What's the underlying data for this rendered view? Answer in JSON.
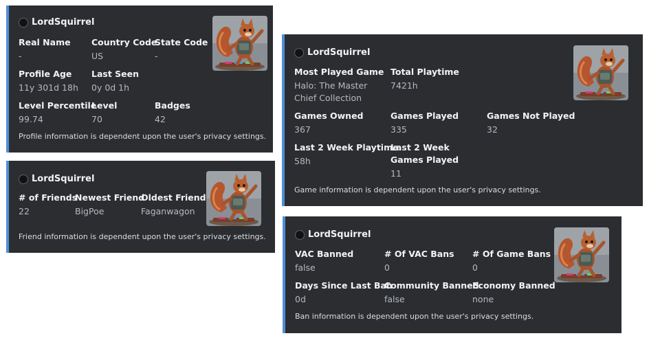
{
  "colors": {
    "embed_bg": "#2b2d31",
    "accent": "#4f8fd8",
    "page_bg": "#ffffff"
  },
  "profile": {
    "author": "LordSquirrel",
    "fields": [
      {
        "name": "Real Name",
        "value": "-"
      },
      {
        "name": "Country Code",
        "value": "US"
      },
      {
        "name": "State Code",
        "value": "-"
      },
      {
        "name": "Profile Age",
        "value": "11y 301d 18h"
      },
      {
        "name": "Last Seen",
        "value": "0y 0d 1h"
      },
      {
        "name": "Level Percentile",
        "value": "99.74"
      },
      {
        "name": "Level",
        "value": "70"
      },
      {
        "name": "Badges",
        "value": "42"
      }
    ],
    "footer": "Profile information is dependent upon the user's privacy settings."
  },
  "friends": {
    "author": "LordSquirrel",
    "fields": [
      {
        "name": "# of Friends",
        "value": "22"
      },
      {
        "name": "Newest Friend",
        "value": "BigPoe"
      },
      {
        "name": "Oldest Friend",
        "value": "Faganwagon"
      }
    ],
    "footer": "Friend information is dependent upon the user's privacy settings."
  },
  "games": {
    "author": "LordSquirrel",
    "fields": [
      {
        "name": "Most Played Game",
        "value": "Halo: The Master Chief Collection"
      },
      {
        "name": "Total Playtime",
        "value": "7421h"
      },
      {
        "name": "Games Owned",
        "value": "367"
      },
      {
        "name": "Games Played",
        "value": "335"
      },
      {
        "name": "Games Not Played",
        "value": "32"
      },
      {
        "name": "Last 2 Week Playtime",
        "value": "58h"
      },
      {
        "name": "Last 2 Week Games Played",
        "value": "11"
      }
    ],
    "footer": "Game information is dependent upon the user's privacy settings."
  },
  "bans": {
    "author": "LordSquirrel",
    "fields": [
      {
        "name": "VAC Banned",
        "value": "false"
      },
      {
        "name": "# Of VAC Bans",
        "value": "0"
      },
      {
        "name": "# Of Game Bans",
        "value": "0"
      },
      {
        "name": "Days Since Last Ban",
        "value": "0d"
      },
      {
        "name": "Community Banned",
        "value": "false"
      },
      {
        "name": "Economy Banned",
        "value": "none"
      }
    ],
    "footer": "Ban information is dependent upon the user's privacy settings."
  }
}
